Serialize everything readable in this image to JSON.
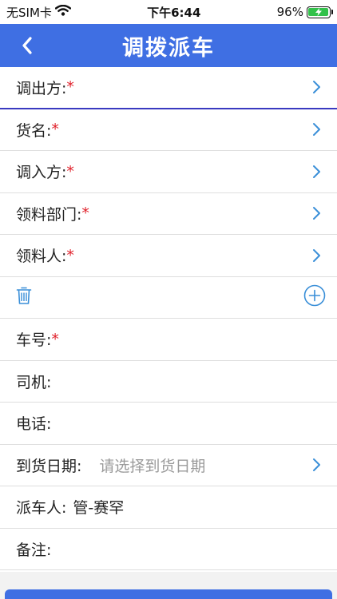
{
  "status_bar": {
    "carrier": "无SIM卡",
    "time": "下午6:44",
    "battery": "96%"
  },
  "nav": {
    "title": "调拨派车"
  },
  "form": {
    "rows": [
      {
        "label": "调出方:",
        "required": "*"
      },
      {
        "label": "货名:",
        "required": "*"
      },
      {
        "label": "调入方:",
        "required": "*"
      },
      {
        "label": "领料部门:",
        "required": "*"
      },
      {
        "label": "领料人:",
        "required": "*"
      }
    ],
    "plate": {
      "label": "车号:",
      "required": "*"
    },
    "driver": {
      "label": "司机:"
    },
    "phone": {
      "label": "电话:"
    },
    "arrival_date": {
      "label": "到货日期:",
      "placeholder": "请选择到货日期"
    },
    "dispatcher": {
      "label": "派车人:",
      "value": "管-赛罕"
    },
    "remarks": {
      "label": "备注:"
    }
  },
  "colors": {
    "accent": "#3f6fe3",
    "required": "#e0212b",
    "icon": "#3a8fd8"
  },
  "icons": {
    "back": "chevron-left-icon",
    "chevron": "chevron-right-icon",
    "delete": "trash-icon",
    "add": "plus-circle-icon"
  }
}
